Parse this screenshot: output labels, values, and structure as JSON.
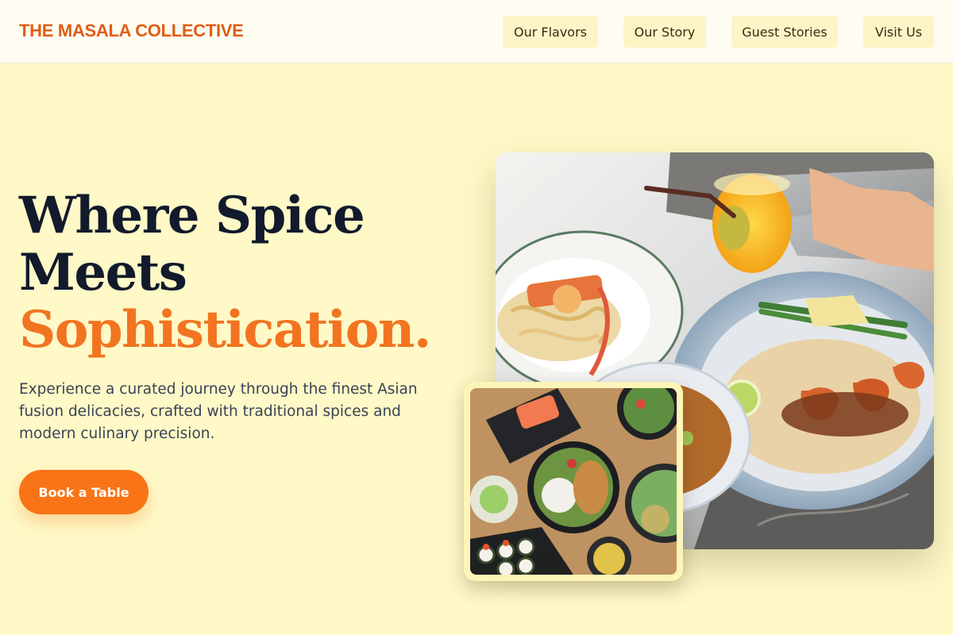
{
  "brand": {
    "name": "THE MASALA COLLECTIVE"
  },
  "nav": {
    "items": [
      {
        "label": "Our Flavors"
      },
      {
        "label": "Our Story"
      },
      {
        "label": "Guest Stories"
      },
      {
        "label": "Visit Us"
      }
    ]
  },
  "hero": {
    "title_line1": "Where Spice",
    "title_line2": "Meets",
    "title_accent": "Sophistication.",
    "description": "Experience a curated journey through the finest Asian fusion delicacies, crafted with traditional spices and modern culinary precision.",
    "cta_label": "Book a Table"
  },
  "colors": {
    "brand": "#e05d14",
    "accent": "#f27420",
    "cta_bg": "#f97417",
    "page_bg": "#fef9c7",
    "heading": "#121a2c"
  }
}
